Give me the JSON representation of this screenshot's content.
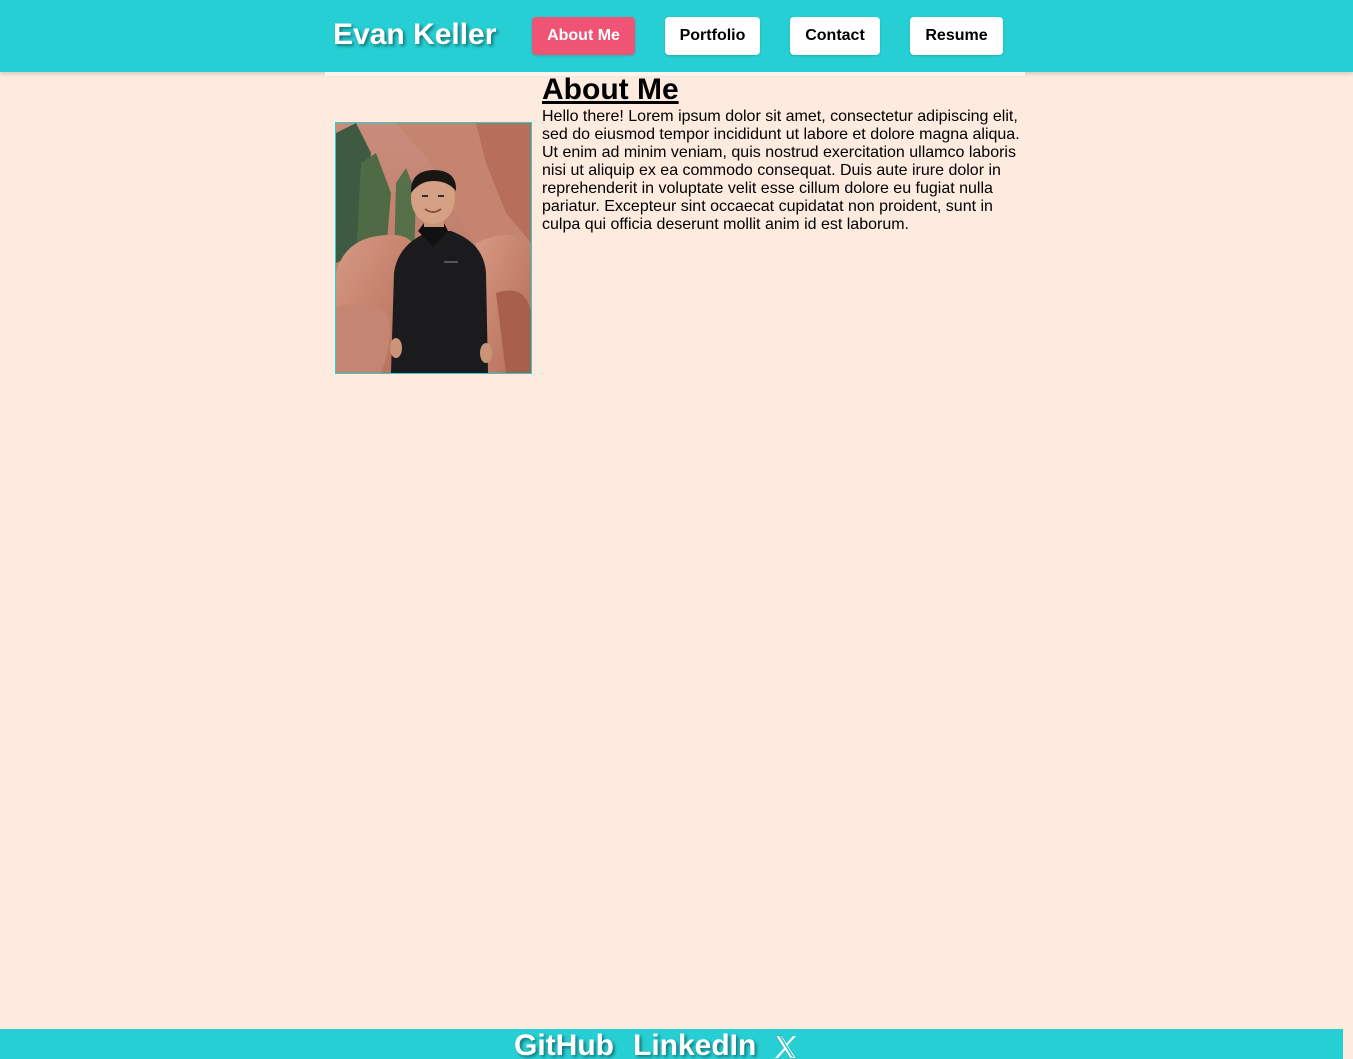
{
  "header": {
    "site_title": "Evan Keller",
    "nav": [
      {
        "label": "About Me",
        "active": true
      },
      {
        "label": "Portfolio",
        "active": false
      },
      {
        "label": "Contact",
        "active": false
      },
      {
        "label": "Resume",
        "active": false
      }
    ]
  },
  "about": {
    "heading": "About Me",
    "text": "Hello there! Lorem ipsum dolor sit amet, consectetur adipiscing elit, sed do eiusmod tempor incididunt ut labore et dolore magna aliqua. Ut enim ad minim veniam, quis nostrud exercitation ullamco laboris nisi ut aliquip ex ea commodo consequat. Duis aute irure dolor in reprehenderit in voluptate velit esse cillum dolore eu fugiat nulla pariatur. Excepteur sint occaecat cupidatat non proident, sunt in culpa qui officia deserunt mollit anim id est laborum."
  },
  "footer": {
    "links": [
      "GitHub",
      "LinkedIn"
    ],
    "x_icon": "x-logo-icon"
  },
  "colors": {
    "header_bg": "#26cfd3",
    "page_bg": "#fdebdf",
    "active_nav": "#ef5474"
  }
}
